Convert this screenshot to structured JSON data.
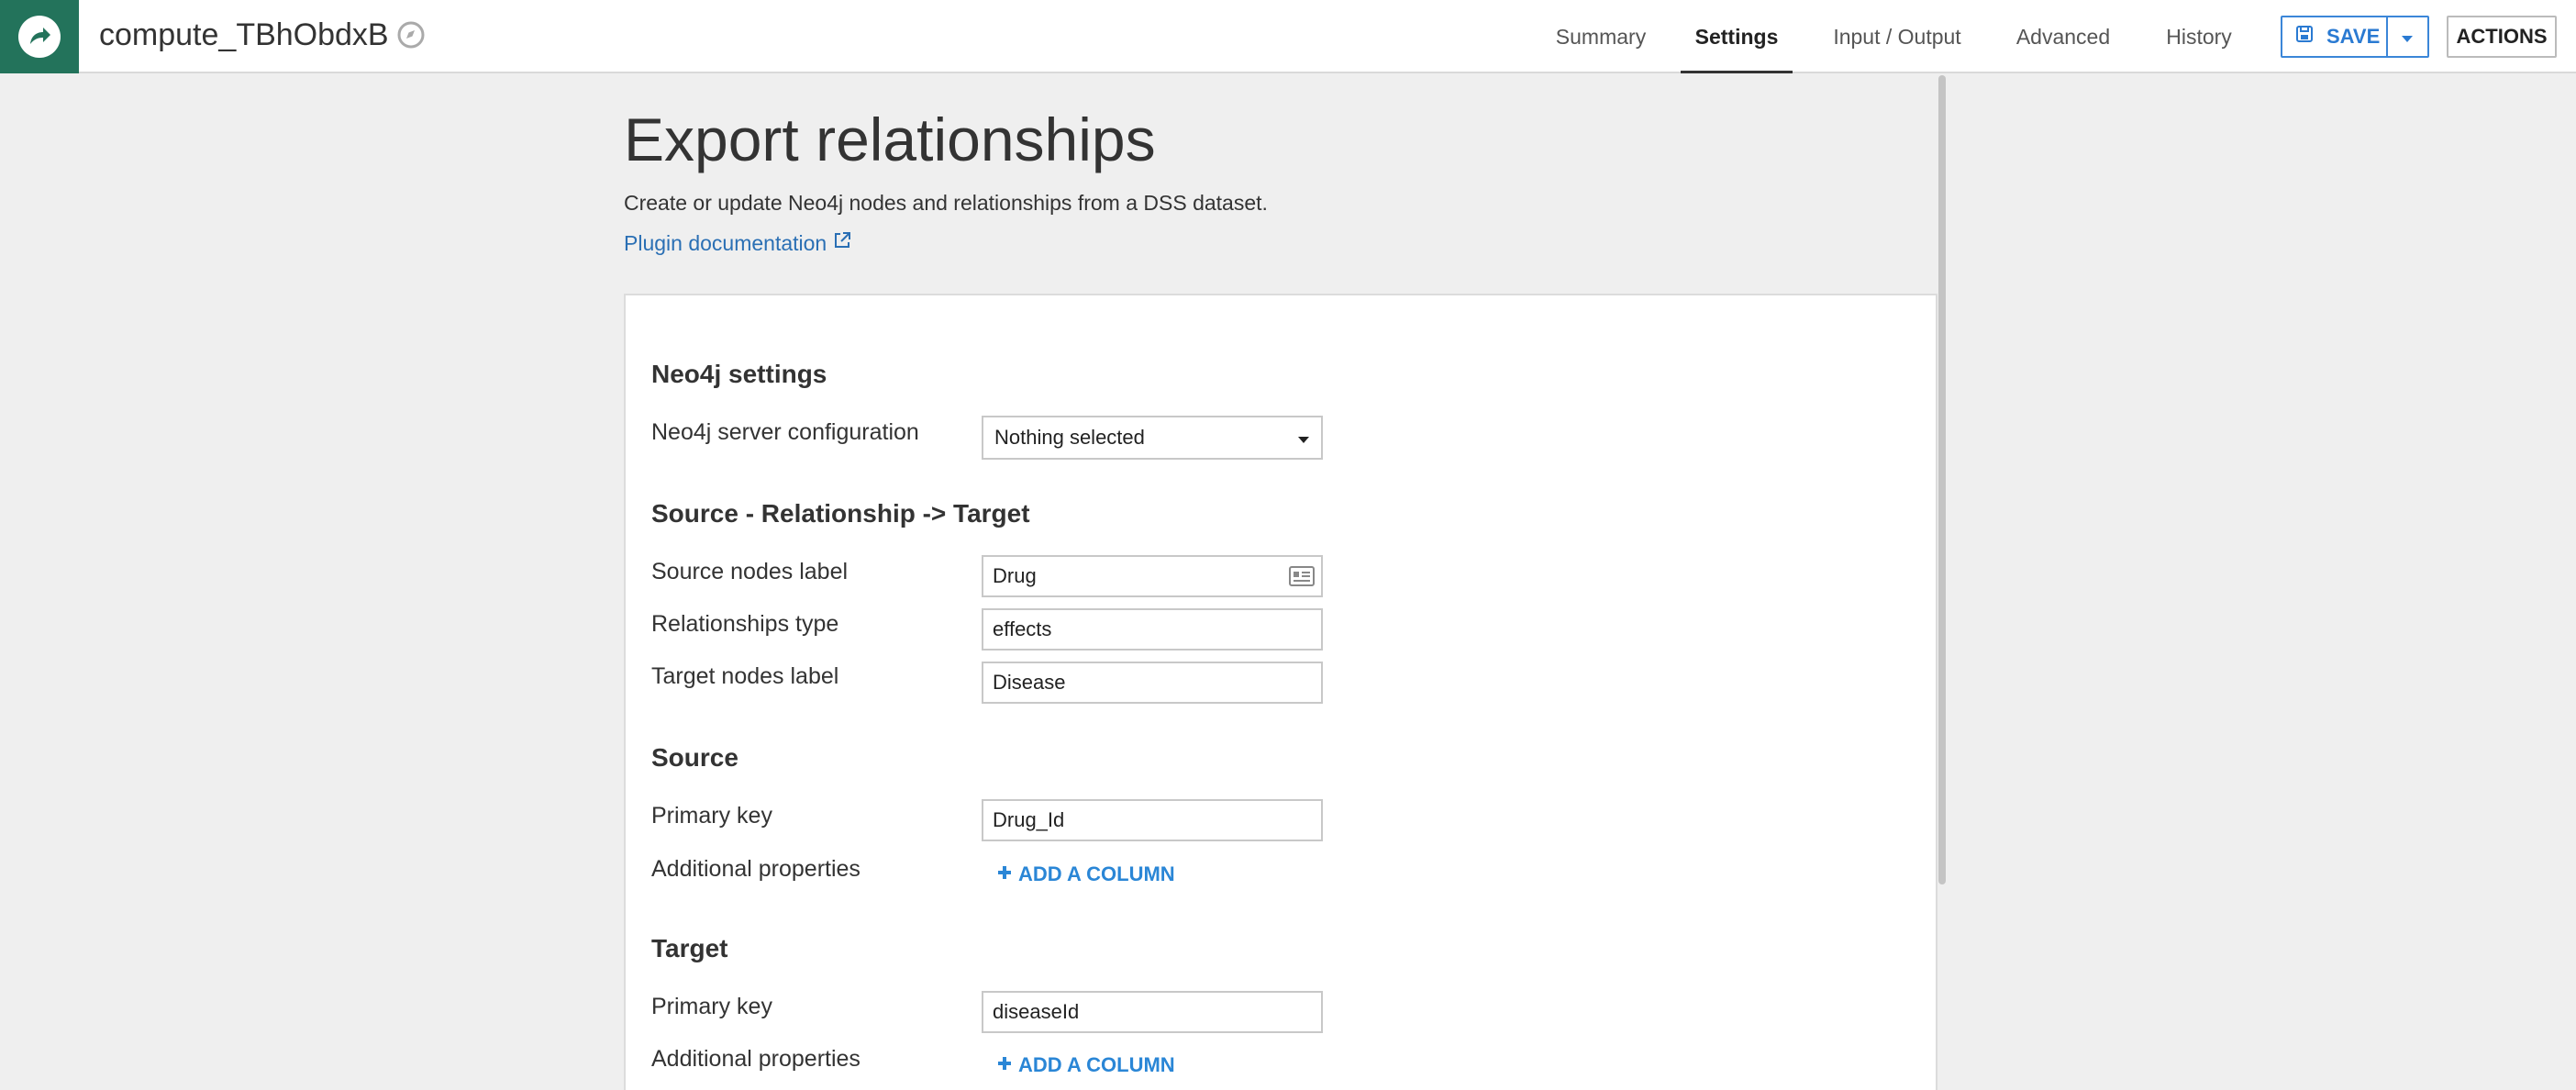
{
  "header": {
    "recipe_name": "compute_TBhObdxB",
    "tabs": [
      {
        "label": "Summary"
      },
      {
        "label": "Settings"
      },
      {
        "label": "Input / Output"
      },
      {
        "label": "Advanced"
      },
      {
        "label": "History"
      }
    ],
    "active_tab": "Settings",
    "save_label": "SAVE",
    "actions_label": "ACTIONS"
  },
  "colors": {
    "brand": "#23735b",
    "accent": "#2a7ad2",
    "link": "#2a6fb4"
  },
  "page": {
    "title": "Export relationships",
    "description": "Create or update Neo4j nodes and relationships from a DSS dataset.",
    "doc_link": "Plugin documentation"
  },
  "sections": {
    "neo4j": {
      "title": "Neo4j settings",
      "server_label": "Neo4j server configuration",
      "server_value": "Nothing selected"
    },
    "relationship": {
      "title": "Source - Relationship -> Target",
      "source_label": "Source nodes label",
      "source_value": "Drug",
      "type_label": "Relationships type",
      "type_value": "effects",
      "target_label": "Target nodes label",
      "target_value": "Disease"
    },
    "source": {
      "title": "Source",
      "pk_label": "Primary key",
      "pk_value": "Drug_Id",
      "props_label": "Additional properties",
      "add_column": "ADD A COLUMN"
    },
    "target": {
      "title": "Target",
      "pk_label": "Primary key",
      "pk_value": "diseaseId",
      "props_label": "Additional properties",
      "add_column": "ADD A COLUMN"
    }
  }
}
